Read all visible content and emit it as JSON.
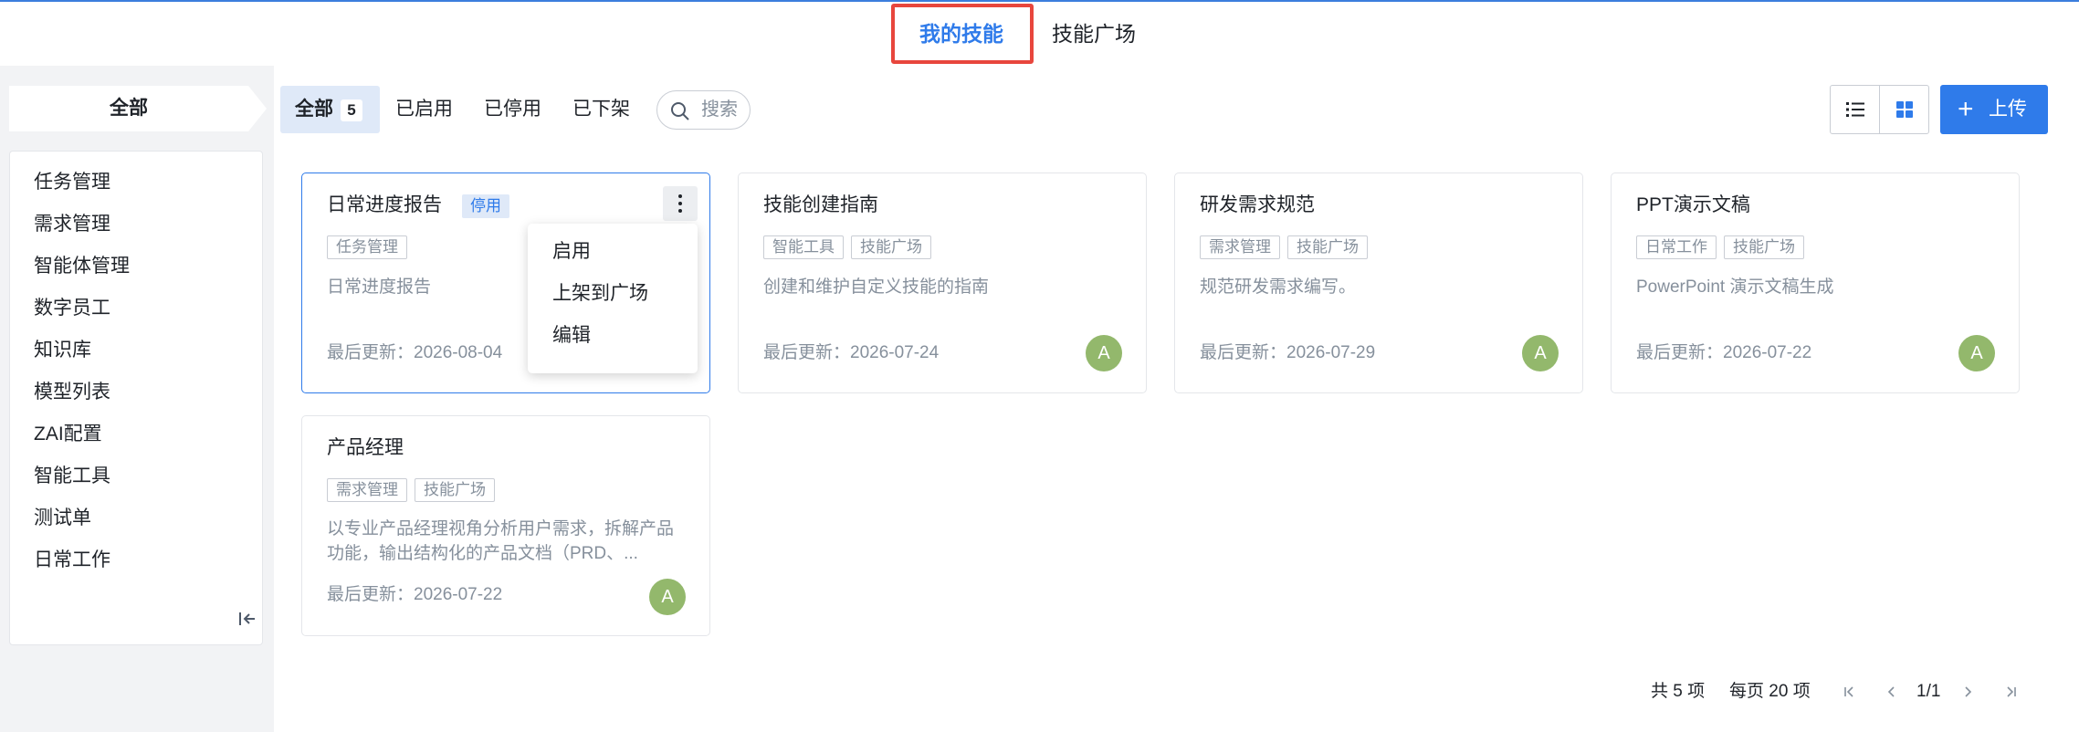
{
  "top_tabs": {
    "my_skills": "我的技能",
    "skill_plaza": "技能广场"
  },
  "sidebar": {
    "header": "全部",
    "items": [
      "任务管理",
      "需求管理",
      "智能体管理",
      "数字员工",
      "知识库",
      "模型列表",
      "ZAI配置",
      "智能工具",
      "测试单",
      "日常工作"
    ]
  },
  "filters": {
    "all_label": "全部",
    "all_count": "5",
    "enabled": "已启用",
    "disabled": "已停用",
    "delisted": "已下架",
    "search_placeholder": "搜索"
  },
  "toolbar": {
    "upload_label": "上传",
    "plus_icon": "plus-icon",
    "list_view_icon": "list-view-icon",
    "grid_view_icon": "grid-view-icon"
  },
  "colors": {
    "accent": "#2f7bea",
    "avatar": "#93b86c",
    "highlight_box": "#e8463d"
  },
  "cards": [
    {
      "title": "日常进度报告",
      "status": "停用",
      "tags": [
        "任务管理"
      ],
      "desc": "日常进度报告",
      "updated": "最后更新：2026-08-04",
      "avatar": ""
    },
    {
      "title": "技能创建指南",
      "status": "",
      "tags": [
        "智能工具",
        "技能广场"
      ],
      "desc": "创建和维护自定义技能的指南",
      "updated": "最后更新：2026-07-24",
      "avatar": "A"
    },
    {
      "title": "研发需求规范",
      "status": "",
      "tags": [
        "需求管理",
        "技能广场"
      ],
      "desc": "规范研发需求编写。",
      "updated": "最后更新：2026-07-29",
      "avatar": "A"
    },
    {
      "title": "PPT演示文稿",
      "status": "",
      "tags": [
        "日常工作",
        "技能广场"
      ],
      "desc": "PowerPoint 演示文稿生成",
      "updated": "最后更新：2026-07-22",
      "avatar": "A"
    },
    {
      "title": "产品经理",
      "status": "",
      "tags": [
        "需求管理",
        "技能广场"
      ],
      "desc": "以专业产品经理视角分析用户需求，拆解产品功能，输出结构化的产品文档（PRD、...",
      "updated": "最后更新：2026-07-22",
      "avatar": "A"
    }
  ],
  "context_menu": [
    "启用",
    "上架到广场",
    "编辑"
  ],
  "pagination": {
    "total": "共 5 项",
    "page_size": "每页 20 项",
    "page": "1/1"
  }
}
